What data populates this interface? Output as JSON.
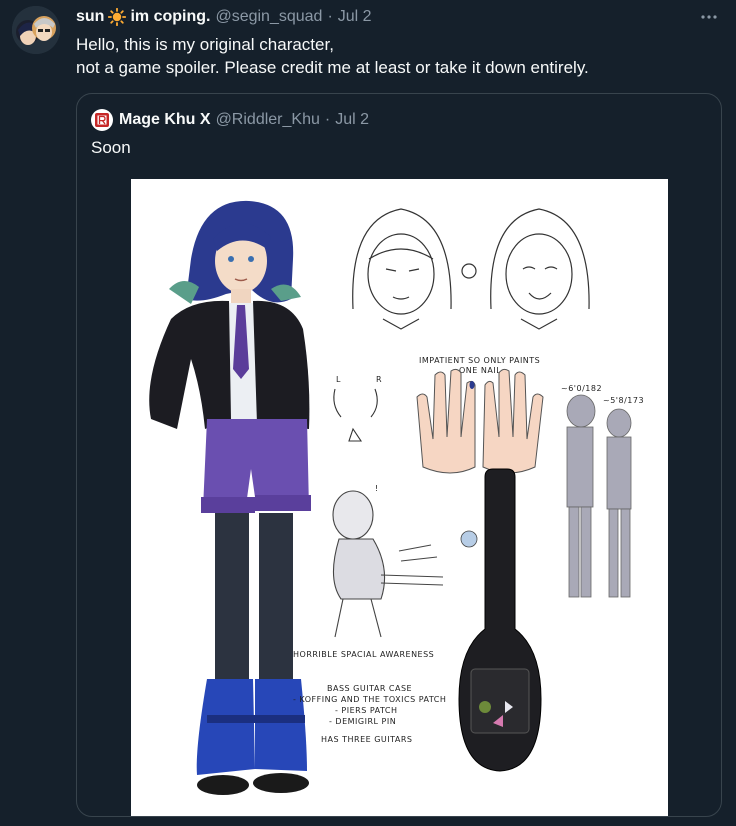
{
  "tweet": {
    "display_name": "sun",
    "display_name_suffix": "im coping.",
    "handle": "@segin_squad",
    "separator": "·",
    "date": "Jul 2",
    "lines": [
      "Hello, this is my original character,",
      "not a game spoiler. Please credit me at least or take it down entirely."
    ],
    "more_label": "···"
  },
  "quote": {
    "display_name": "Mage Khu X",
    "handle": "@Riddler_Khu",
    "separator": "·",
    "date": "Jul 2",
    "text": "Soon",
    "image": {
      "notes": {
        "impatient": "IMPATIENT SO ONLY PAINTS",
        "impatient2": "ONE NAIL",
        "left": "L",
        "right": "R",
        "height1": "~6'0/182",
        "height2": "~5'8/173",
        "spacial": "HORRIBLE SPACIAL AWARENESS",
        "case1": "BASS GUITAR CASE",
        "case2": "- KOFFING AND THE TOXICS PATCH",
        "case3": "- PIERS PATCH",
        "case4": "- DEMIGIRL PIN",
        "case5": "HAS THREE GUITARS"
      }
    }
  },
  "colors": {
    "background": "#15202b",
    "text": "#f7f9f9",
    "muted": "#8b98a5",
    "border": "#38444d",
    "hair": "#2b3a8f",
    "shorts": "#6a4fb0",
    "boots": "#2747b8"
  }
}
